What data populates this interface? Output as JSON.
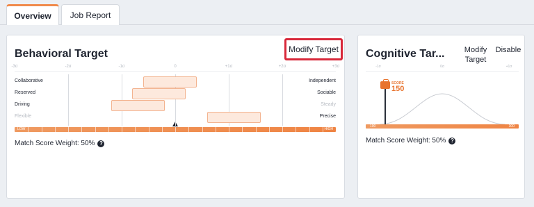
{
  "tabs": [
    {
      "label": "Overview",
      "active": true
    },
    {
      "label": "Job Report",
      "active": false
    }
  ],
  "behavioral": {
    "title": "Behavioral Target",
    "modify_label": "Modify Target",
    "sigma_labels": [
      "-3σ",
      "-2σ",
      "-1σ",
      "0",
      "+1σ",
      "+2σ",
      "+3σ"
    ],
    "traits": [
      {
        "left": "Collaborative",
        "right": "Independent",
        "left_muted": false,
        "right_muted": false,
        "range": [
          -0.6,
          0.4
        ]
      },
      {
        "left": "Reserved",
        "right": "Sociable",
        "left_muted": false,
        "right_muted": false,
        "range": [
          -0.8,
          0.2
        ]
      },
      {
        "left": "Driving",
        "right": "Steady",
        "left_muted": false,
        "right_muted": true,
        "range": [
          -1.2,
          -0.2
        ]
      },
      {
        "left": "Flexible",
        "right": "Precise",
        "left_muted": true,
        "right_muted": false,
        "range": [
          0.6,
          1.6
        ]
      }
    ],
    "scale_low": "LOW",
    "scale_high": "HIGH",
    "marker_sigma": 0,
    "weight_label": "Match Score Weight: 50%"
  },
  "cognitive": {
    "title": "Cognitive Tar...",
    "modify_label": "Modify Target",
    "disable_label": "Disable",
    "sigma_labels": [
      "-1σ",
      "0σ",
      "+1σ"
    ],
    "score_label": "SCORE",
    "score_value": "150",
    "bar_low": "100",
    "bar_high": "300",
    "weight_label": "Match Score Weight: 50%"
  },
  "colors": {
    "accent": "#f08a4b",
    "highlight_border": "#d8283a",
    "range_fill": "#fde9dd",
    "range_border": "#f3b38f"
  },
  "icons": {
    "help": "question-circle-icon",
    "briefcase": "briefcase-icon"
  }
}
